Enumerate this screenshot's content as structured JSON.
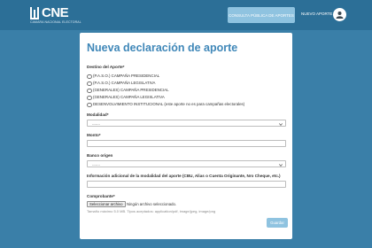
{
  "header": {
    "logo_text": "CNE",
    "logo_subtitle": "CAMARA NACIONAL ELECTORAL",
    "consulta_button": "CONSULTA PÚBLICA DE APORTES",
    "nuevo_aporte_link": "NUEVO APORTE"
  },
  "form": {
    "title": "Nueva declaración de aporte",
    "destino_label": "Destino del Aporte*",
    "destino_options": [
      "(P.A.S.O.) CAMPAÑA PRESIDENCIAL",
      "(P.A.S.O.) CAMPAÑA LEGISLATIVA",
      "(GENERALES) CAMPAÑA PRESIDENCIAL",
      "(GENERALES) CAMPAÑA LEGISLATIVA",
      "DESENVOLVIMIENTO INSTITUCIONAL (este aporte no es para campañas electorales)"
    ],
    "modalidad_label": "Modalidad*",
    "modalidad_value": "-------",
    "monto_label": "Monto*",
    "monto_value": "",
    "banco_label": "Banco origen",
    "banco_value": "-------",
    "info_label": "Información adicional de la modalidad del aporte (CBU, Alias o Cuenta Originante, Nro Cheque, etc.)",
    "info_value": "",
    "comprobante_label": "Comprobante*",
    "file_button": "Seleccionar archivo",
    "file_status": "Ningún archivo seleccionado.",
    "file_hint": "Tamaño máximo 5.0 MB.  Tipos aceptados: application/pdf, image/jpeg, image/png",
    "submit_label": "Guardar"
  },
  "colors": {
    "background": "#3a7fa8",
    "topbar": "#2c6f97",
    "title": "#3f87b8",
    "button": "#8fc3e0"
  }
}
